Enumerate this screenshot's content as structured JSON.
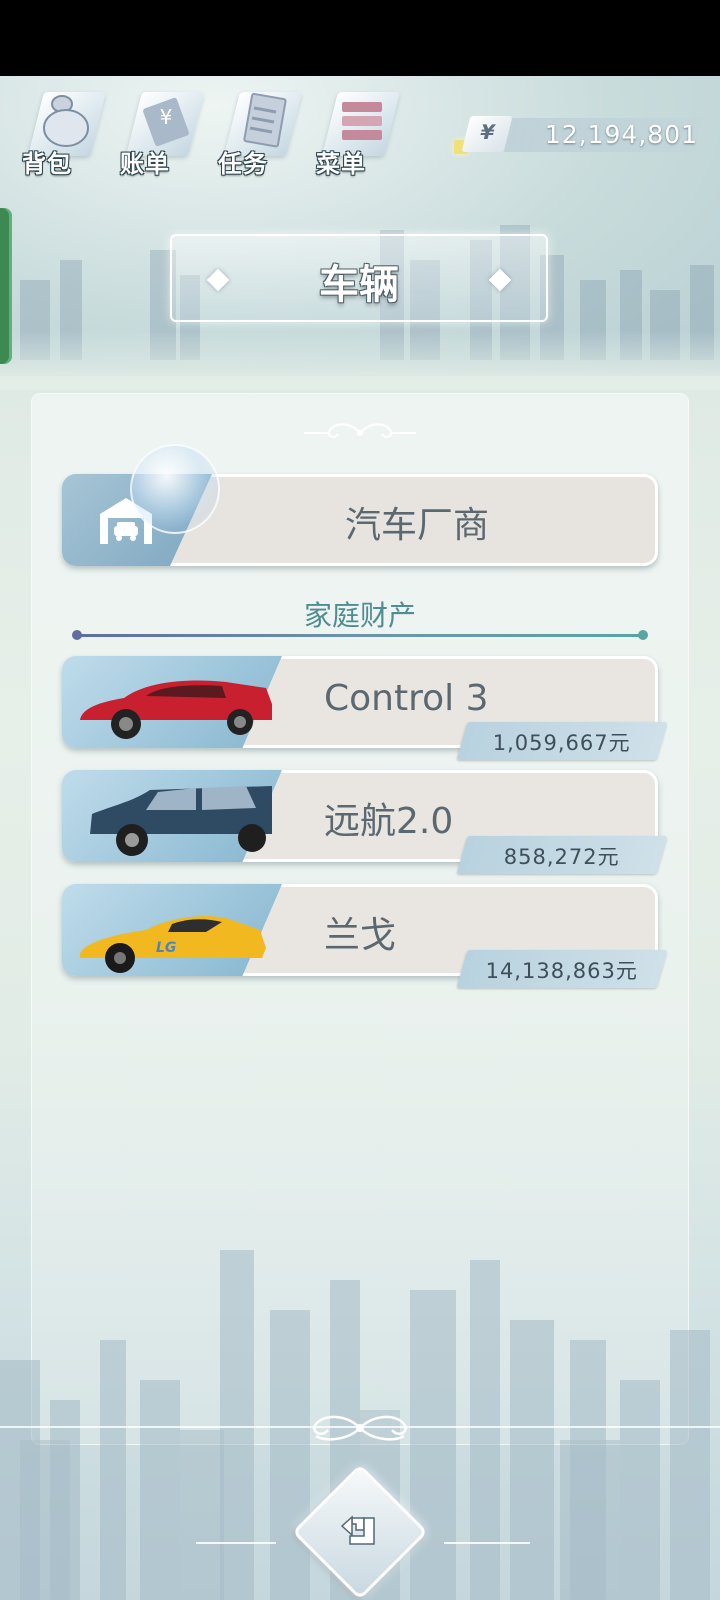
{
  "menu": [
    {
      "label": "背包",
      "icon": "bag-icon"
    },
    {
      "label": "账单",
      "icon": "bill-icon"
    },
    {
      "label": "任务",
      "icon": "task-icon"
    },
    {
      "label": "菜单",
      "icon": "menu-icon"
    }
  ],
  "money": {
    "symbol": "¥",
    "value": "12,194,801"
  },
  "page_title": "车辆",
  "manufacturer_button": {
    "label": "汽车厂商",
    "icon": "garage-icon"
  },
  "section_title": "家庭财产",
  "cars": [
    {
      "name": "Control 3",
      "price": "1,059,667元",
      "color": "#c8202e",
      "icon": "red-sedan-icon"
    },
    {
      "name": "远航2.0",
      "price": "858,272元",
      "color": "#2f4a63",
      "icon": "blue-suv-icon"
    },
    {
      "name": "兰戈",
      "price": "14,138,863元",
      "color": "#f2b81f",
      "icon": "yellow-sportscar-icon"
    }
  ],
  "back_button": {
    "icon": "back-arrow-icon"
  },
  "colors": {
    "accent": "#4f8d91",
    "panel": "#eef4f1",
    "status_bar": "#000000"
  }
}
